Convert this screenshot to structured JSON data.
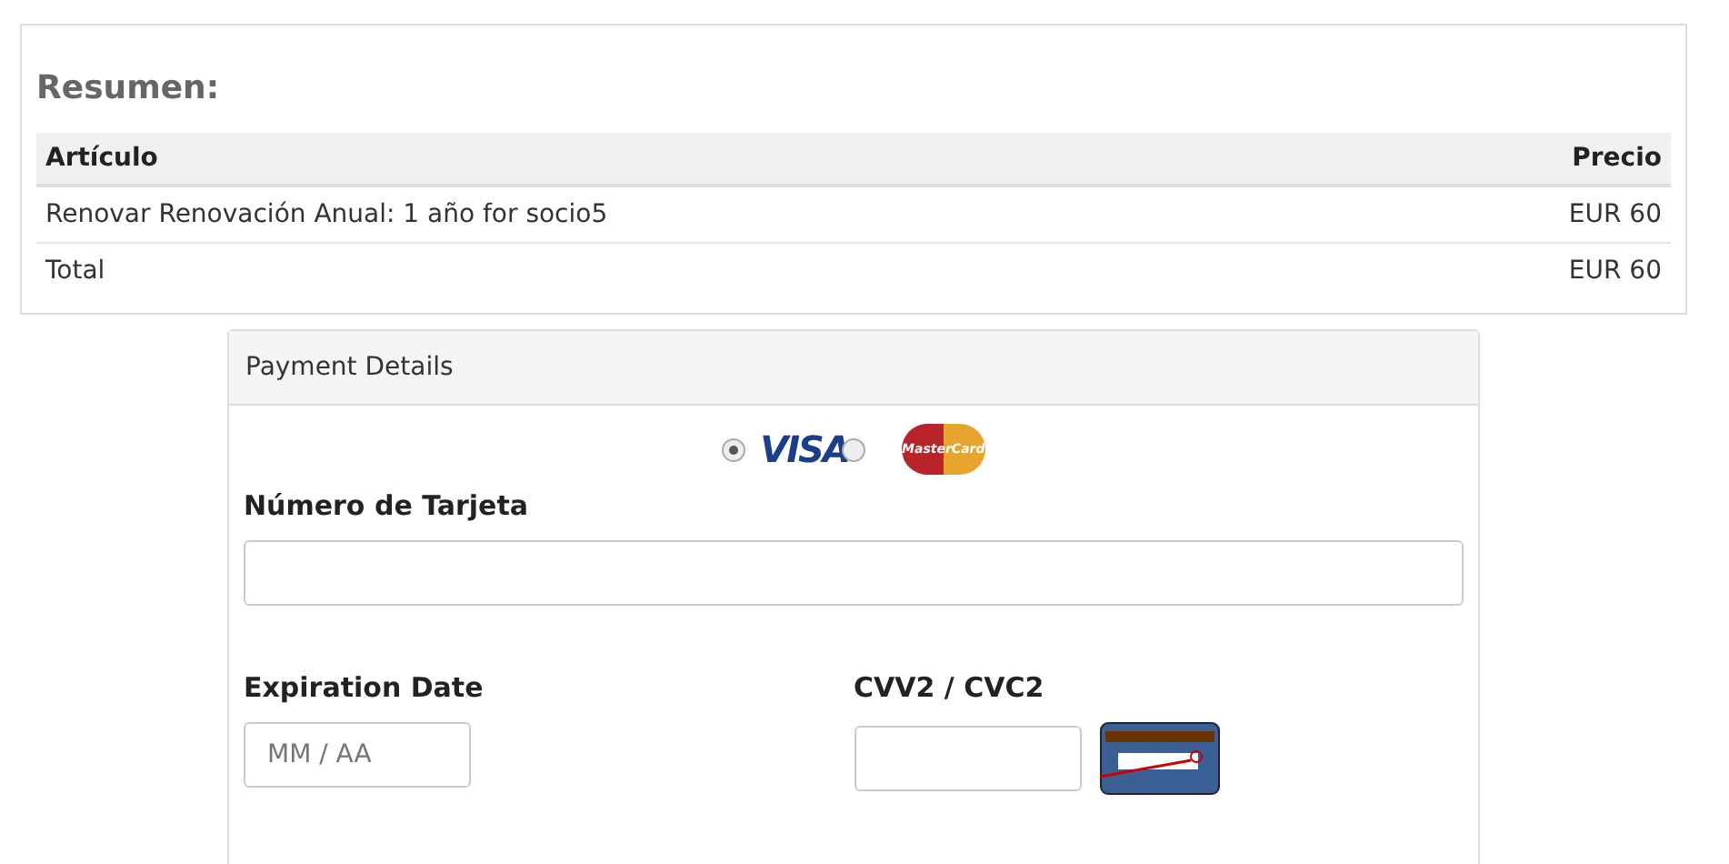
{
  "summary": {
    "title": "Resumen:",
    "columns": [
      "Artículo",
      "Precio"
    ],
    "rows": [
      {
        "item": "Renovar Renovación Anual: 1 año for socio5",
        "price": "EUR 60"
      },
      {
        "item": "Total",
        "price": "EUR 60"
      }
    ]
  },
  "payment": {
    "title": "Payment Details",
    "card_types": [
      {
        "label": "VISA",
        "kind": "visa",
        "selected": true
      },
      {
        "label": "MasterCard",
        "kind": "mastercard",
        "selected": false
      }
    ],
    "card_number": {
      "label": "Número de Tarjeta"
    },
    "expiration": {
      "label": "Expiration Date",
      "placeholder": "MM / AA"
    },
    "cvv": {
      "label": "CVV2 / CVC2"
    }
  }
}
